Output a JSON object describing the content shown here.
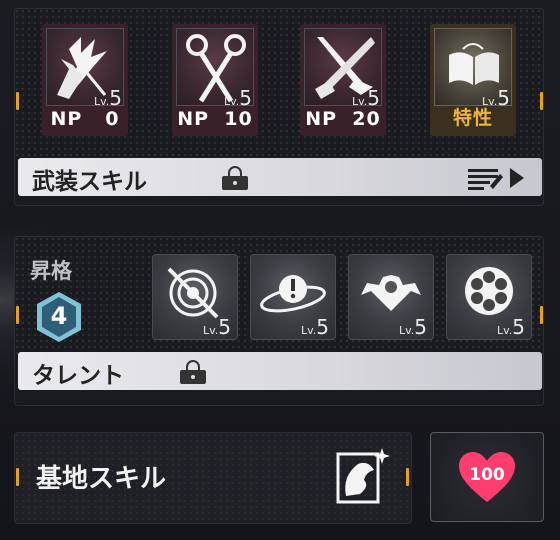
{
  "skills": [
    {
      "icon": "burst-fist-icon",
      "np_label": "NP",
      "np_value": "0",
      "lv_prefix": "Lv.",
      "lv_value": "5"
    },
    {
      "icon": "crossed-pins-icon",
      "np_label": "NP",
      "np_value": "10",
      "lv_prefix": "Lv.",
      "lv_value": "5"
    },
    {
      "icon": "crossed-blades-icon",
      "np_label": "NP",
      "np_value": "20",
      "lv_prefix": "Lv.",
      "lv_value": "5"
    },
    {
      "icon": "open-book-icon",
      "trait_label": "特性",
      "lv_prefix": "Lv.",
      "lv_value": "5"
    }
  ],
  "weapon_skill": {
    "label": "武装スキル",
    "locked": true,
    "action_icon": "list-arrow-icon"
  },
  "ascension": {
    "label": "昇格",
    "rank": "4",
    "skills": [
      {
        "icon": "crossed-target-icon",
        "lv_prefix": "Lv.",
        "lv_value": "5"
      },
      {
        "icon": "alert-orbit-icon",
        "lv_prefix": "Lv.",
        "lv_value": "5"
      },
      {
        "icon": "winged-emblem-icon",
        "lv_prefix": "Lv.",
        "lv_value": "5"
      },
      {
        "icon": "revolver-cylinder-icon",
        "lv_prefix": "Lv.",
        "lv_value": "5"
      }
    ]
  },
  "talent": {
    "label": "タレント",
    "locked": true
  },
  "base_skill": {
    "label": "基地スキル",
    "icon": "leaf-card-icon"
  },
  "affinity": {
    "value": "100",
    "icon": "heart-icon",
    "color": "#ff3d6e"
  },
  "colors": {
    "accent": "#e3a21f",
    "np_red": "#3a2129",
    "trait_gold": "#f0b63a"
  }
}
